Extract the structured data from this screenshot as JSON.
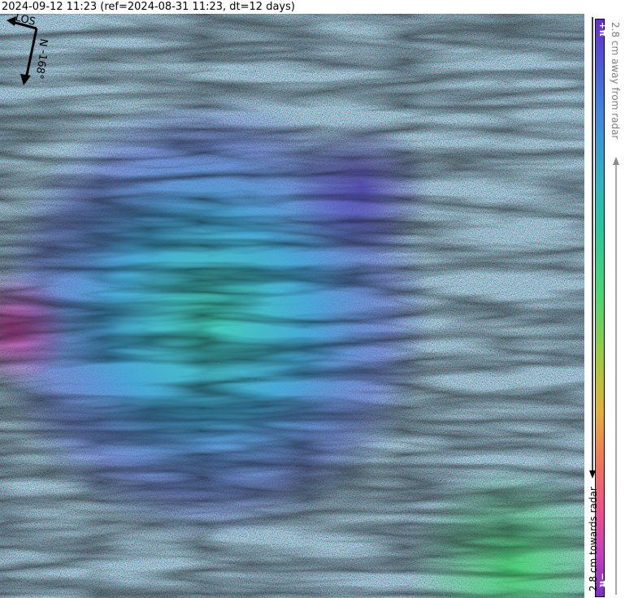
{
  "header": {
    "title": "2024-09-12 11:23 (ref=2024-08-31 11:23, dt=12 days)"
  },
  "compass": {
    "los_label": "LOS",
    "north_label": "N",
    "heading_label": "-168°"
  },
  "colorbar": {
    "top_symbol": "+π",
    "bottom_symbol": "−π",
    "away_label": "2.8 cm away from radar",
    "towards_label": "2.8 cm towards radar",
    "colors": [
      "#6a2bd0",
      "#3f86e0",
      "#27c6a3",
      "#4ad870",
      "#a9c739",
      "#f07a54",
      "#ee4d8f",
      "#7b2ec8"
    ]
  }
}
